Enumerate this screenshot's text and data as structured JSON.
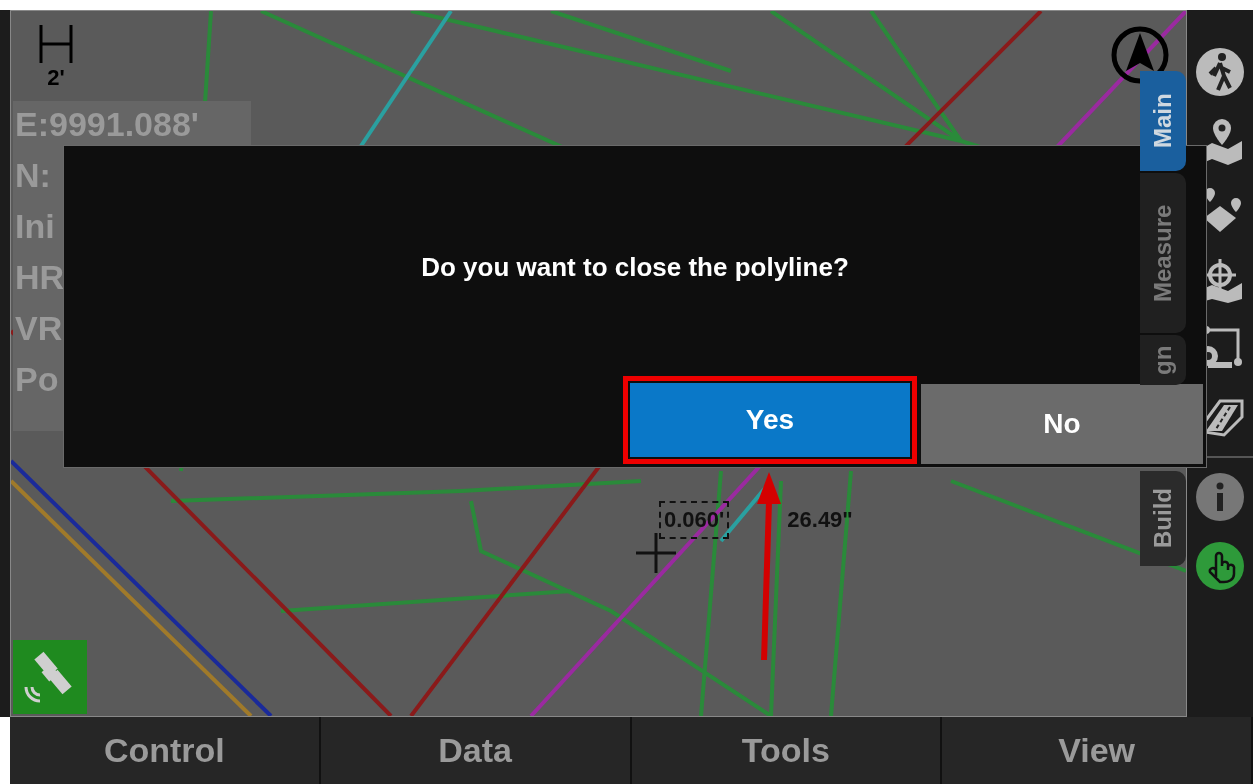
{
  "map": {
    "scale": "2'",
    "readout": [
      "E:9991.088'",
      "N:",
      "Ini",
      "HR",
      "VR",
      "Po"
    ],
    "measurements": [
      {
        "kind": "boxed",
        "text": "0.060'"
      },
      {
        "kind": "plain",
        "text": "26.49\""
      }
    ]
  },
  "side_tabs": [
    {
      "label": "Main",
      "selected": true
    },
    {
      "label": "Measure",
      "selected": false
    },
    {
      "label": "gn",
      "selected": false
    },
    {
      "label": "Build",
      "selected": false
    }
  ],
  "dialog": {
    "message": "Do you want to close the polyline?",
    "buttons": [
      {
        "label": "Yes",
        "kind": "primary"
      },
      {
        "label": "No",
        "kind": "secondary"
      }
    ]
  },
  "bottom_tabs": [
    "Control",
    "Data",
    "Tools",
    "View"
  ]
}
